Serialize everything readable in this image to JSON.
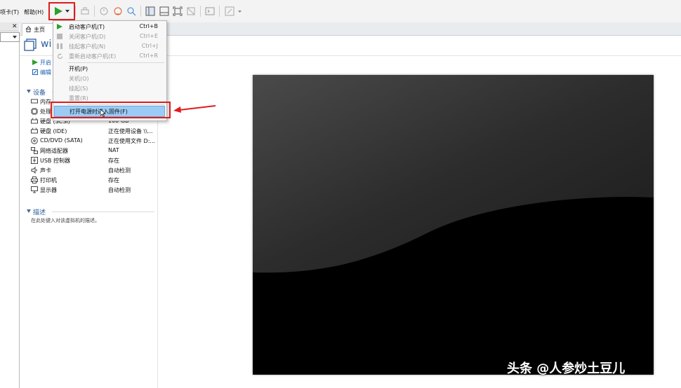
{
  "menubar": {
    "tab_menu": "项卡(T)",
    "help_menu": "帮助(H)"
  },
  "tabs": [
    {
      "label": "主页",
      "icon": "home-icon"
    }
  ],
  "vm": {
    "title": "wi",
    "actions": [
      {
        "label": "开启",
        "icon": "play-icon"
      },
      {
        "label": "编辑",
        "icon": "edit-icon"
      }
    ]
  },
  "devices": {
    "section_title": "设备",
    "items": [
      {
        "name": "内存",
        "value": "",
        "icon": "memory-icon"
      },
      {
        "name": "处理",
        "value": "",
        "icon": "processor-icon"
      },
      {
        "name": "硬盘 (SCSI)",
        "value": "100 GB",
        "icon": "hard-disk-icon"
      },
      {
        "name": "硬盘 (IDE)",
        "value": "正在使用设备 \\\\...",
        "icon": "hard-disk-icon"
      },
      {
        "name": "CD/DVD (SATA)",
        "value": "正在使用文件 D:...",
        "icon": "cd-dvd-icon"
      },
      {
        "name": "网络适配器",
        "value": "NAT",
        "icon": "network-icon"
      },
      {
        "name": "USB 控制器",
        "value": "存在",
        "icon": "usb-icon"
      },
      {
        "name": "声卡",
        "value": "自动检测",
        "icon": "sound-icon"
      },
      {
        "name": "打印机",
        "value": "存在",
        "icon": "printer-icon"
      },
      {
        "name": "显示器",
        "value": "自动检测",
        "icon": "monitor-icon"
      }
    ]
  },
  "description": {
    "section_title": "描述",
    "placeholder": "在此处键入对该虚拟机的描述。"
  },
  "power_menu": {
    "items": [
      {
        "label": "启动客户机(T)",
        "shortcut": "Ctrl+B",
        "enabled": true,
        "icon": "play-icon"
      },
      {
        "label": "关闭客户机(D)",
        "shortcut": "Ctrl+E",
        "enabled": false,
        "icon": "stop-icon"
      },
      {
        "label": "挂起客户机(N)",
        "shortcut": "Ctrl+J",
        "enabled": false,
        "icon": "pause-icon"
      },
      {
        "label": "重新启动客户机(E)",
        "shortcut": "Ctrl+R",
        "enabled": false,
        "icon": "restart-icon"
      },
      {
        "label": "开机(P)",
        "shortcut": "",
        "enabled": true
      },
      {
        "label": "关机(O)",
        "shortcut": "",
        "enabled": false
      },
      {
        "label": "挂起(S)",
        "shortcut": "",
        "enabled": false
      },
      {
        "label": "重置(R)",
        "shortcut": "",
        "enabled": false
      },
      {
        "label": "打开电源时进入固件(F)",
        "shortcut": "",
        "enabled": true,
        "highlighted": true
      }
    ]
  },
  "watermark": "头条 @人参炒土豆儿",
  "colors": {
    "accent": "#2a5d9e",
    "link": "#1b5fb0",
    "highlight": "#9ccbf5",
    "annotation_red": "#e01b1b",
    "play_green": "#2e9e2e"
  }
}
